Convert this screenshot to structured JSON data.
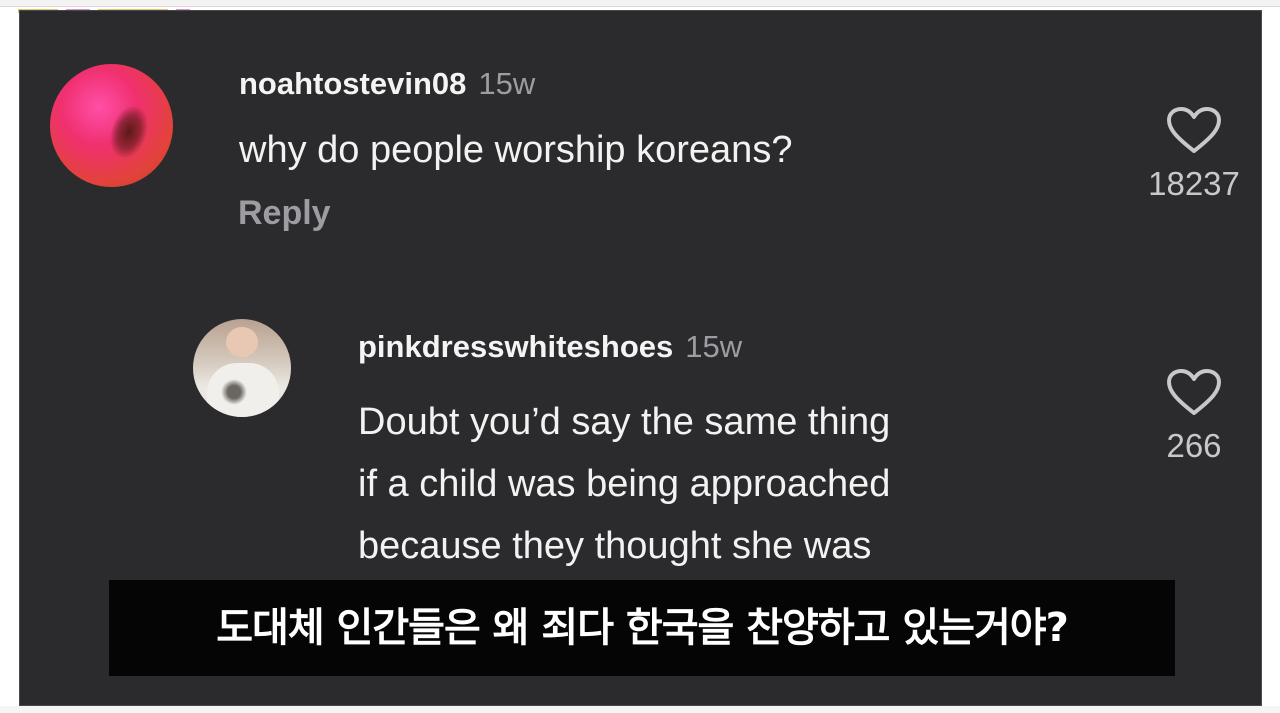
{
  "comments": [
    {
      "username": "noahtostevin08",
      "time": "15w",
      "text": "why do people worship koreans?",
      "reply_label": "Reply",
      "likes": "18237"
    },
    {
      "username": "pinkdresswhiteshoes",
      "time": "15w",
      "text_lines": [
        "Doubt you’d say the same thing",
        "if a child was being approached",
        "because they thought she was"
      ],
      "likes": "266"
    }
  ],
  "subtitle": "도대체 인간들은 왜 죄다 한국을 찬양하고 있는거야?",
  "icons": {
    "like": "heart-outline-icon"
  },
  "colors": {
    "panel_background": "#2b2b2d",
    "username": "#f4f4f4",
    "secondary_text": "#9c9ca2",
    "subtitle_background": "#050505"
  }
}
